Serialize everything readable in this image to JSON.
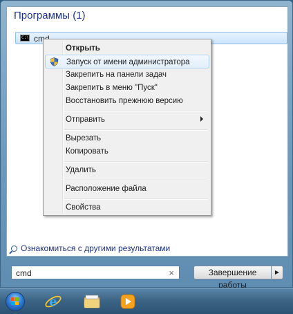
{
  "programs": {
    "section_title": "Программы (1)",
    "result_label": "cmd",
    "result_icon": "cmd-console-icon"
  },
  "context_menu": {
    "items": [
      {
        "label": "Открыть",
        "bold": true
      },
      {
        "label": "Запуск от имени администратора",
        "icon": "uac-shield-icon",
        "highlighted": true
      },
      {
        "label": "Закрепить на панели задач"
      },
      {
        "label": "Закрепить в меню \"Пуск\""
      },
      {
        "label": "Восстановить прежнюю версию"
      },
      {
        "label": "Отправить",
        "submenu": true
      },
      {
        "label": "Вырезать"
      },
      {
        "label": "Копировать"
      },
      {
        "label": "Удалить"
      },
      {
        "label": "Расположение файла"
      },
      {
        "label": "Свойства"
      }
    ]
  },
  "more_results_label": "Ознакомиться с другими результатами",
  "search": {
    "value": "cmd",
    "clear_glyph": "×"
  },
  "shutdown": {
    "label": "Завершение работы",
    "arrow_glyph": "▶"
  },
  "taskbar": {
    "items": [
      "start-orb",
      "internet-explorer-icon",
      "file-explorer-icon",
      "media-player-icon"
    ]
  },
  "colors": {
    "title_blue": "#1e3287",
    "highlight_border": "#aecff7"
  }
}
